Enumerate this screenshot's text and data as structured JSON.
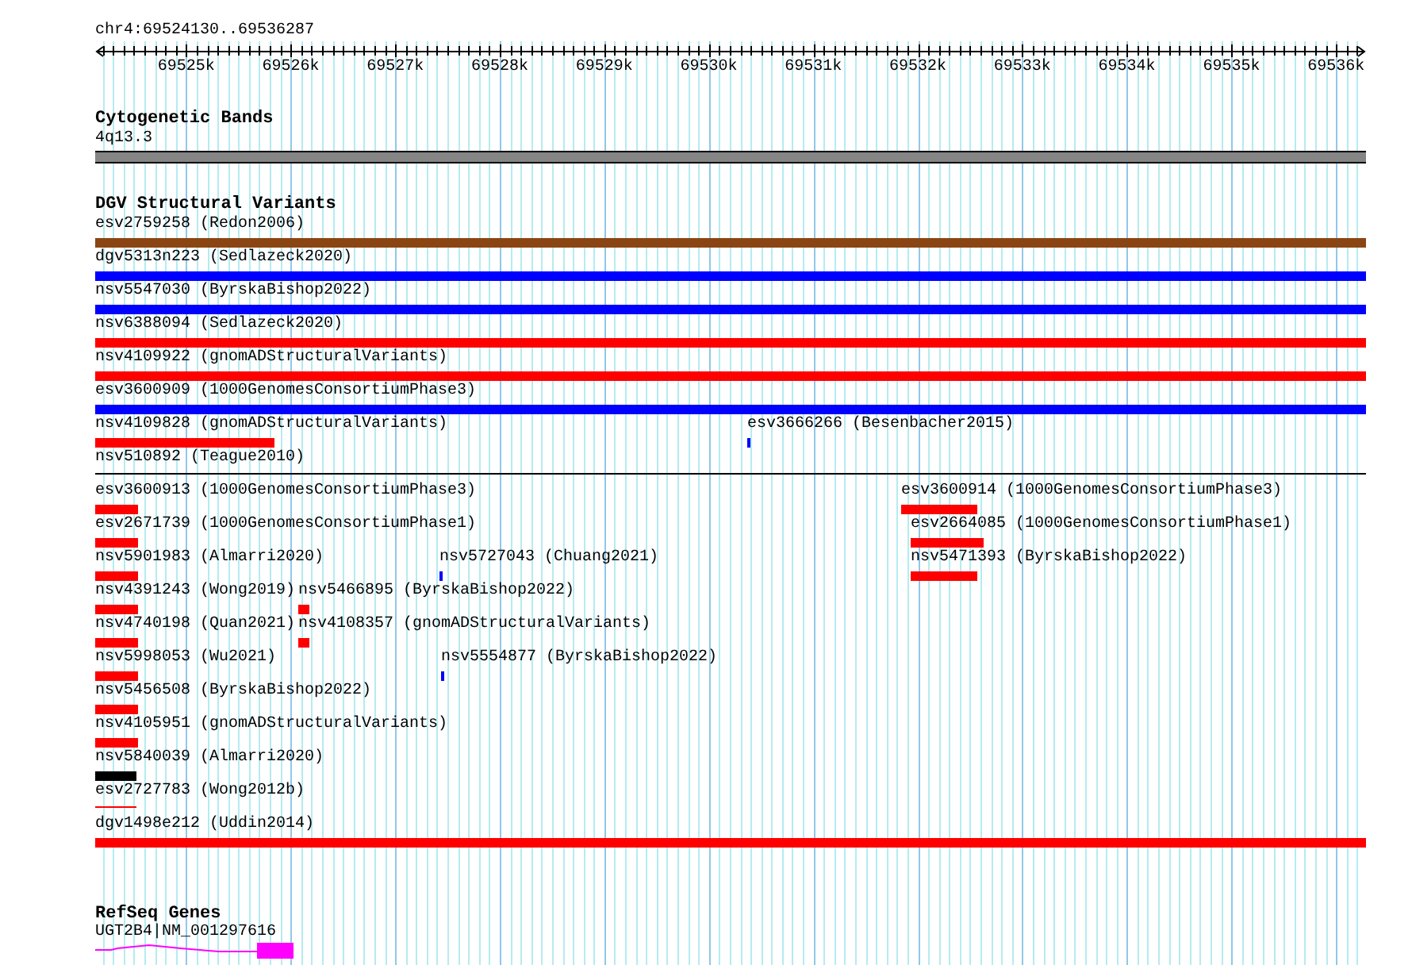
{
  "ruler": {
    "location": "chr4:69524130..69536287",
    "ticks": [
      "69525k",
      "69526k",
      "69527k",
      "69528k",
      "69529k",
      "69530k",
      "69531k",
      "69532k",
      "69533k",
      "69534k",
      "69535k",
      "69536k"
    ]
  },
  "tracks": [
    {
      "kind": "cytoband",
      "title": "Cytogenetic Bands",
      "band": {
        "label": "4q13.3"
      }
    },
    {
      "kind": "variants",
      "title": "DGV Structural Variants",
      "rows": [
        [
          {
            "label": "esv2759258 (Redon2006)",
            "color": "#8b4513",
            "kind": "bar"
          }
        ],
        [
          {
            "label": "dgv5313n223 (Sedlazeck2020)",
            "color": "#0000ff",
            "kind": "bar"
          }
        ],
        [
          {
            "label": "nsv5547030 (ByrskaBishop2022)",
            "color": "#0000ff",
            "kind": "bar"
          }
        ],
        [
          {
            "label": "nsv6388094 (Sedlazeck2020)",
            "color": "#ff0000",
            "kind": "bar"
          }
        ],
        [
          {
            "label": "nsv4109922 (gnomADStructuralVariants)",
            "color": "#ff0000",
            "kind": "bar"
          }
        ],
        [
          {
            "label": "esv3600909 (1000GenomesConsortiumPhase3)",
            "color": "#0000ff",
            "kind": "bar"
          }
        ],
        [
          {
            "label": "nsv4109828 (gnomADStructuralVariants)",
            "color": "#ff0000",
            "kind": "bar"
          },
          {
            "label": "esv3666266 (Besenbacher2015)",
            "color": "#0000ff",
            "kind": "bar"
          }
        ],
        [
          {
            "label": "nsv510892 (Teague2010)",
            "color": "#000000",
            "kind": "line"
          }
        ],
        [
          {
            "label": "esv3600913 (1000GenomesConsortiumPhase3)",
            "color": "#ff0000",
            "kind": "bar"
          },
          {
            "label": "esv3600914 (1000GenomesConsortiumPhase3)",
            "color": "#ff0000",
            "kind": "bar"
          }
        ],
        [
          {
            "label": "esv2671739 (1000GenomesConsortiumPhase1)",
            "color": "#ff0000",
            "kind": "bar"
          },
          {
            "label": "esv2664085 (1000GenomesConsortiumPhase1)",
            "color": "#ff0000",
            "kind": "bar"
          }
        ],
        [
          {
            "label": "nsv5901983 (Almarri2020)",
            "color": "#ff0000",
            "kind": "bar"
          },
          {
            "label": "nsv5727043 (Chuang2021)",
            "color": "#0000ff",
            "kind": "bar"
          },
          {
            "label": "nsv5471393 (ByrskaBishop2022)",
            "color": "#ff0000",
            "kind": "bar"
          }
        ],
        [
          {
            "label": "nsv4391243 (Wong2019)",
            "color": "#ff0000",
            "kind": "bar"
          },
          {
            "label": "nsv5466895 (ByrskaBishop2022)",
            "color": "#ff0000",
            "kind": "bar"
          }
        ],
        [
          {
            "label": "nsv4740198 (Quan2021)",
            "color": "#ff0000",
            "kind": "bar"
          },
          {
            "label": "nsv4108357 (gnomADStructuralVariants)",
            "color": "#ff0000",
            "kind": "bar"
          }
        ],
        [
          {
            "label": "nsv5998053 (Wu2021)",
            "color": "#ff0000",
            "kind": "bar"
          },
          {
            "label": "nsv5554877 (ByrskaBishop2022)",
            "color": "#0000ff",
            "kind": "bar"
          }
        ],
        [
          {
            "label": "nsv5456508 (ByrskaBishop2022)",
            "color": "#ff0000",
            "kind": "bar"
          }
        ],
        [
          {
            "label": "nsv4105951 (gnomADStructuralVariants)",
            "color": "#ff0000",
            "kind": "bar"
          }
        ],
        [
          {
            "label": "nsv5840039 (Almarri2020)",
            "color": "#000000",
            "kind": "bar"
          }
        ],
        [
          {
            "label": "esv2727783 (Wong2012b)",
            "color": "#ff0000",
            "kind": "line"
          }
        ],
        [
          {
            "label": "dgv1498e212 (Uddin2014)",
            "color": "#ff0000",
            "kind": "bar"
          }
        ]
      ]
    },
    {
      "kind": "genes",
      "title": "RefSeq Genes",
      "genes": [
        {
          "label": "UGT2B4|NM_001297616",
          "color": "#ff00ff"
        }
      ]
    }
  ]
}
